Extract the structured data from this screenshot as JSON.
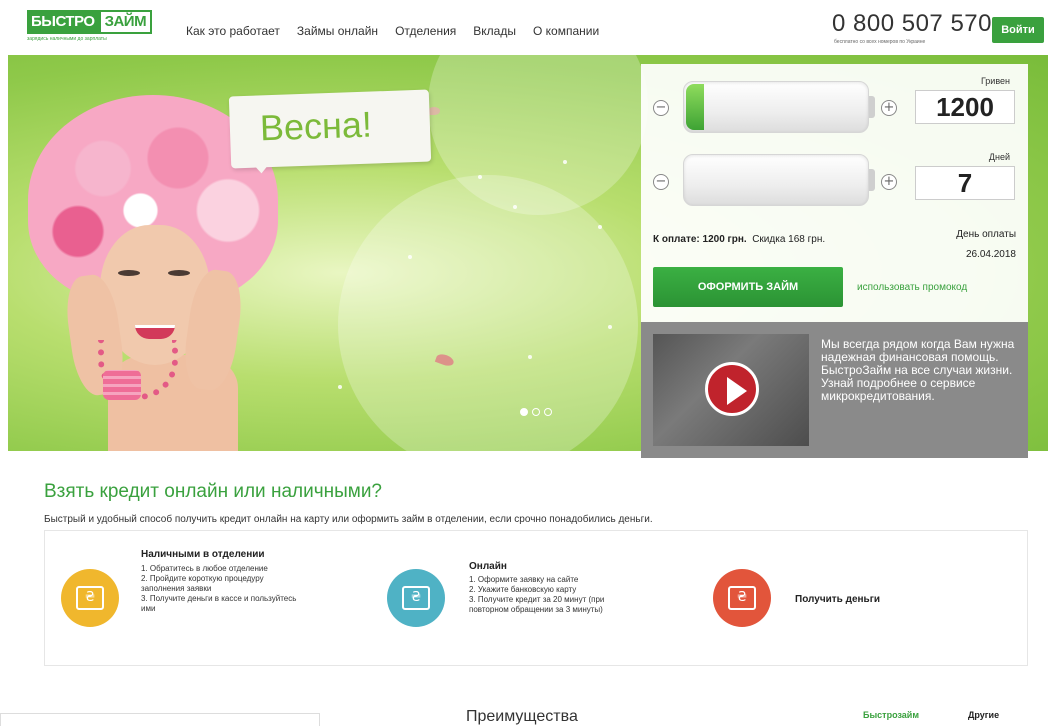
{
  "header": {
    "logo": {
      "part1": "БЫСТРО",
      "part2": "ЗАЙМ",
      "tagline": "зарядись наличными до зарплаты"
    },
    "nav": [
      "Как это работает",
      "Займы онлайн",
      "Отделения",
      "Вклады",
      "О компании"
    ],
    "phone": "0 800 507 570",
    "phone_note": "бесплатно со всех номеров по Украине",
    "login_label": "Войти"
  },
  "hero": {
    "speech": "Весна!",
    "slides": {
      "count": 3,
      "active_index": 0
    }
  },
  "calculator": {
    "amount": {
      "label": "Гривен",
      "value": "1200",
      "minus": "−",
      "plus": "+",
      "fill_fraction": 0.1
    },
    "days": {
      "label": "Дней",
      "value": "7",
      "minus": "−",
      "plus": "+",
      "fill_fraction": 0.0
    },
    "pay_label": "К оплате:",
    "pay_value": "1200 грн.",
    "discount": "Скидка 168 грн.",
    "payday_label": "День оплаты",
    "payday_date": "26.04.2018",
    "apply_label": "ОФОРМИТЬ ЗАЙМ",
    "promo_label": "использовать промокод"
  },
  "video": {
    "text": "Мы всегда рядом когда Вам нужна надежная финансовая помощь. БыстроЗайм на все случаи жизни. Узнай подробнее о сервисе микрокредитования."
  },
  "section": {
    "title": "Взять кредит онлайн или наличными?",
    "subtitle": "Быстрый и удобный способ получить кредит онлайн на карту или оформить займ в отделении, если срочно понадобились деньги.",
    "steps": [
      {
        "title": "Наличными в отделении",
        "icon": "cash-icon",
        "color": "#f0b72d",
        "items": [
          "1. Обратитесь в любое отделение",
          "2. Пройдите короткую процедуру",
          "    заполнения заявки",
          "3. Получите деньги в кассе и пользуйтесь",
          "    ими"
        ]
      },
      {
        "title": "Онлайн",
        "icon": "laptop-icon",
        "color": "#4fb2c5",
        "items": [
          "1. Оформите заявку на сайте",
          "2. Укажите банковскую карту",
          "3. Получите кредит за 20 минут (при",
          "    повторном обращении за 3 минуты)"
        ]
      },
      {
        "title": "Получить деньги",
        "icon": "wallet-icon",
        "color": "#e2553b",
        "items": []
      }
    ]
  },
  "bottom": {
    "advantages_title": "Преимущества",
    "tab_a": "Быстрозайм",
    "tab_b": "Другие"
  },
  "colors": {
    "brand_green": "#3aa13e",
    "video_bg": "#8a8a8a"
  }
}
